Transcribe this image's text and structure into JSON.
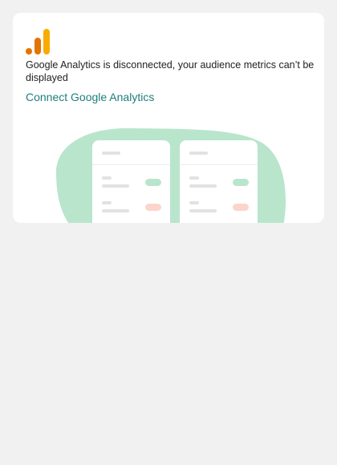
{
  "card": {
    "message": "Google Analytics is disconnected, your audience metrics can’t be displayed",
    "connect_label": "Connect Google Analytics"
  },
  "icons": {
    "logo": "google-analytics-logo-icon",
    "illustration": "analytics-placeholder-illustration"
  },
  "colors": {
    "page_background": "#f1f1f1",
    "card_background": "#ffffff",
    "link": "#1e7e7a",
    "logo_orange": "#f9ab00",
    "logo_dark_orange": "#e37400",
    "illustration_blob": "#b9e5cc",
    "positive_pill": "#b9e5cc",
    "negative_pill": "#fbd5cc"
  }
}
